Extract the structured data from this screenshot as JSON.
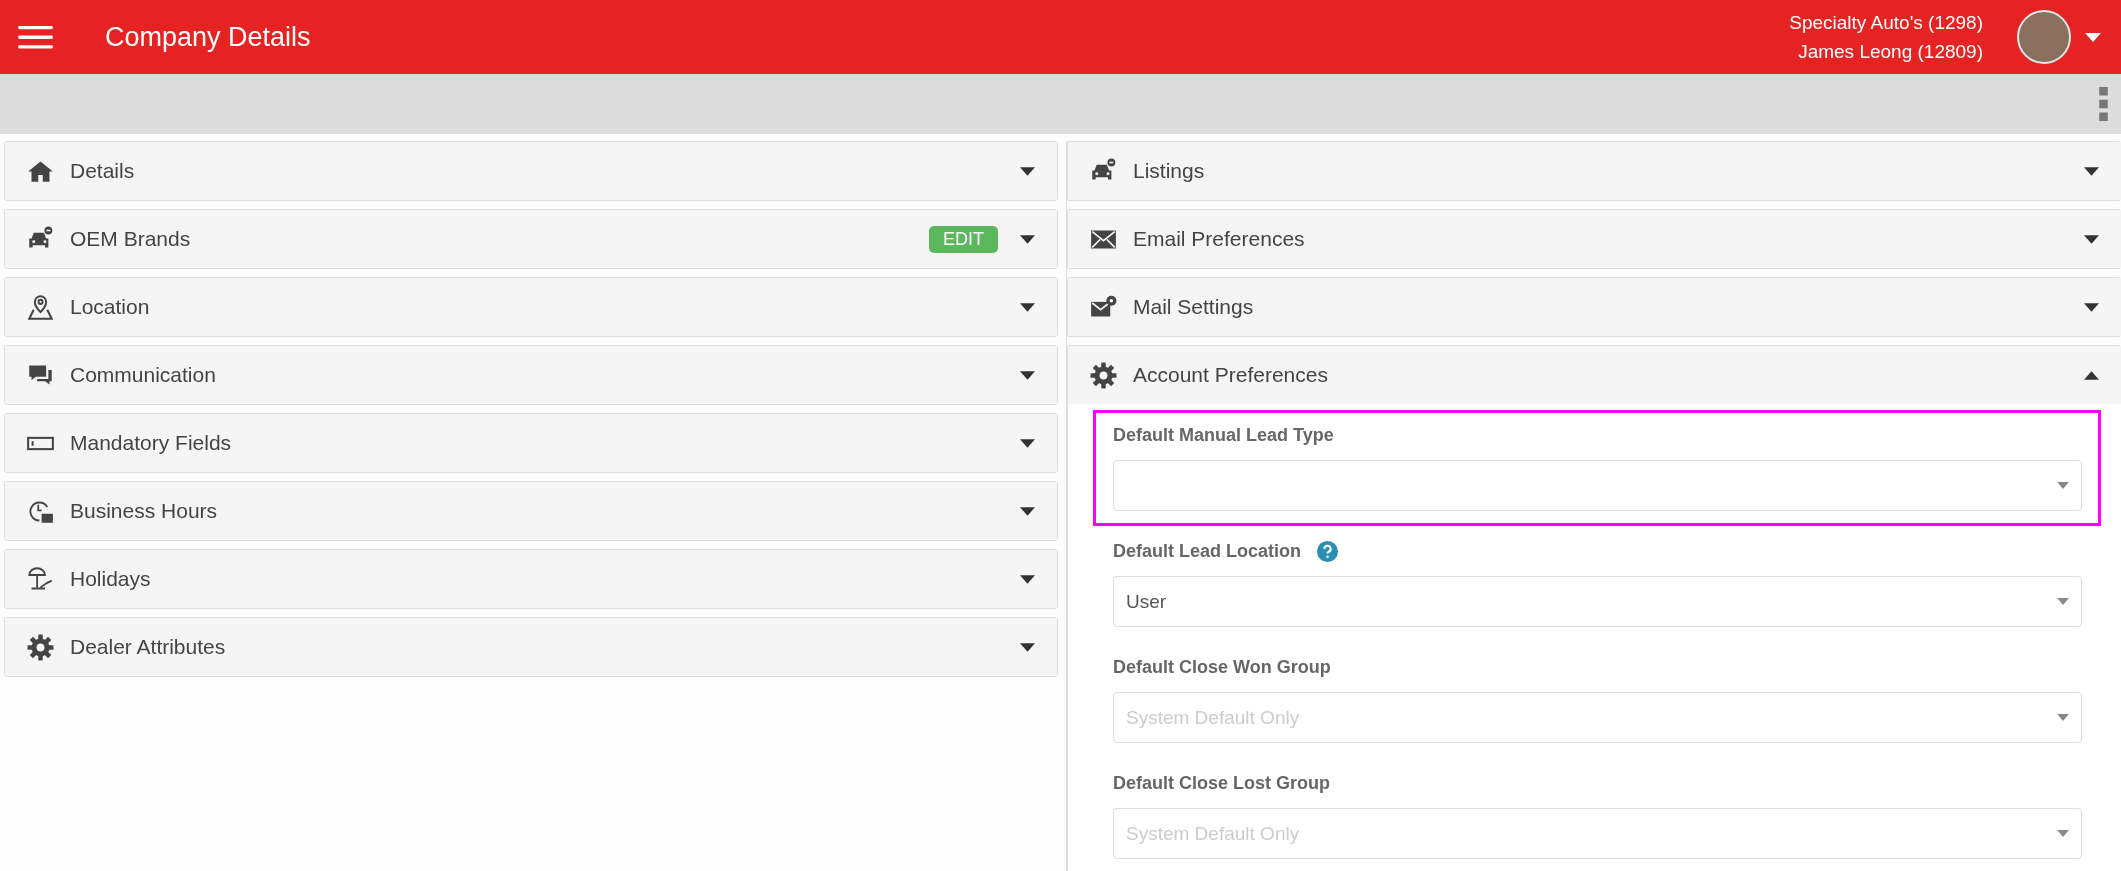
{
  "header": {
    "title": "Company Details",
    "dealer": "Specialty Auto's (1298)",
    "user": "James Leong (12809)"
  },
  "left_panels": [
    {
      "title": "Details",
      "expanded": false
    },
    {
      "title": "OEM Brands",
      "expanded": false,
      "badge": "EDIT"
    },
    {
      "title": "Location",
      "expanded": false
    },
    {
      "title": "Communication",
      "expanded": false
    },
    {
      "title": "Mandatory Fields",
      "expanded": false
    },
    {
      "title": "Business Hours",
      "expanded": false
    },
    {
      "title": "Holidays",
      "expanded": false
    },
    {
      "title": "Dealer Attributes",
      "expanded": false
    }
  ],
  "right_panels": [
    {
      "title": "Listings",
      "expanded": false
    },
    {
      "title": "Email Preferences",
      "expanded": false
    },
    {
      "title": "Mail Settings",
      "expanded": false
    },
    {
      "title": "Account Preferences",
      "expanded": true,
      "fields": [
        {
          "label": "Default Manual Lead Type",
          "highlighted": true,
          "help": false
        },
        {
          "label": "Default Lead Location",
          "value": "User",
          "highlighted": false,
          "help": true
        },
        {
          "label": "Default Close Won Group",
          "placeholder": "System Default Only",
          "highlighted": false,
          "help": false
        },
        {
          "label": "Default Close Lost Group",
          "placeholder": "System Default Only",
          "highlighted": false,
          "help": false
        }
      ]
    }
  ]
}
